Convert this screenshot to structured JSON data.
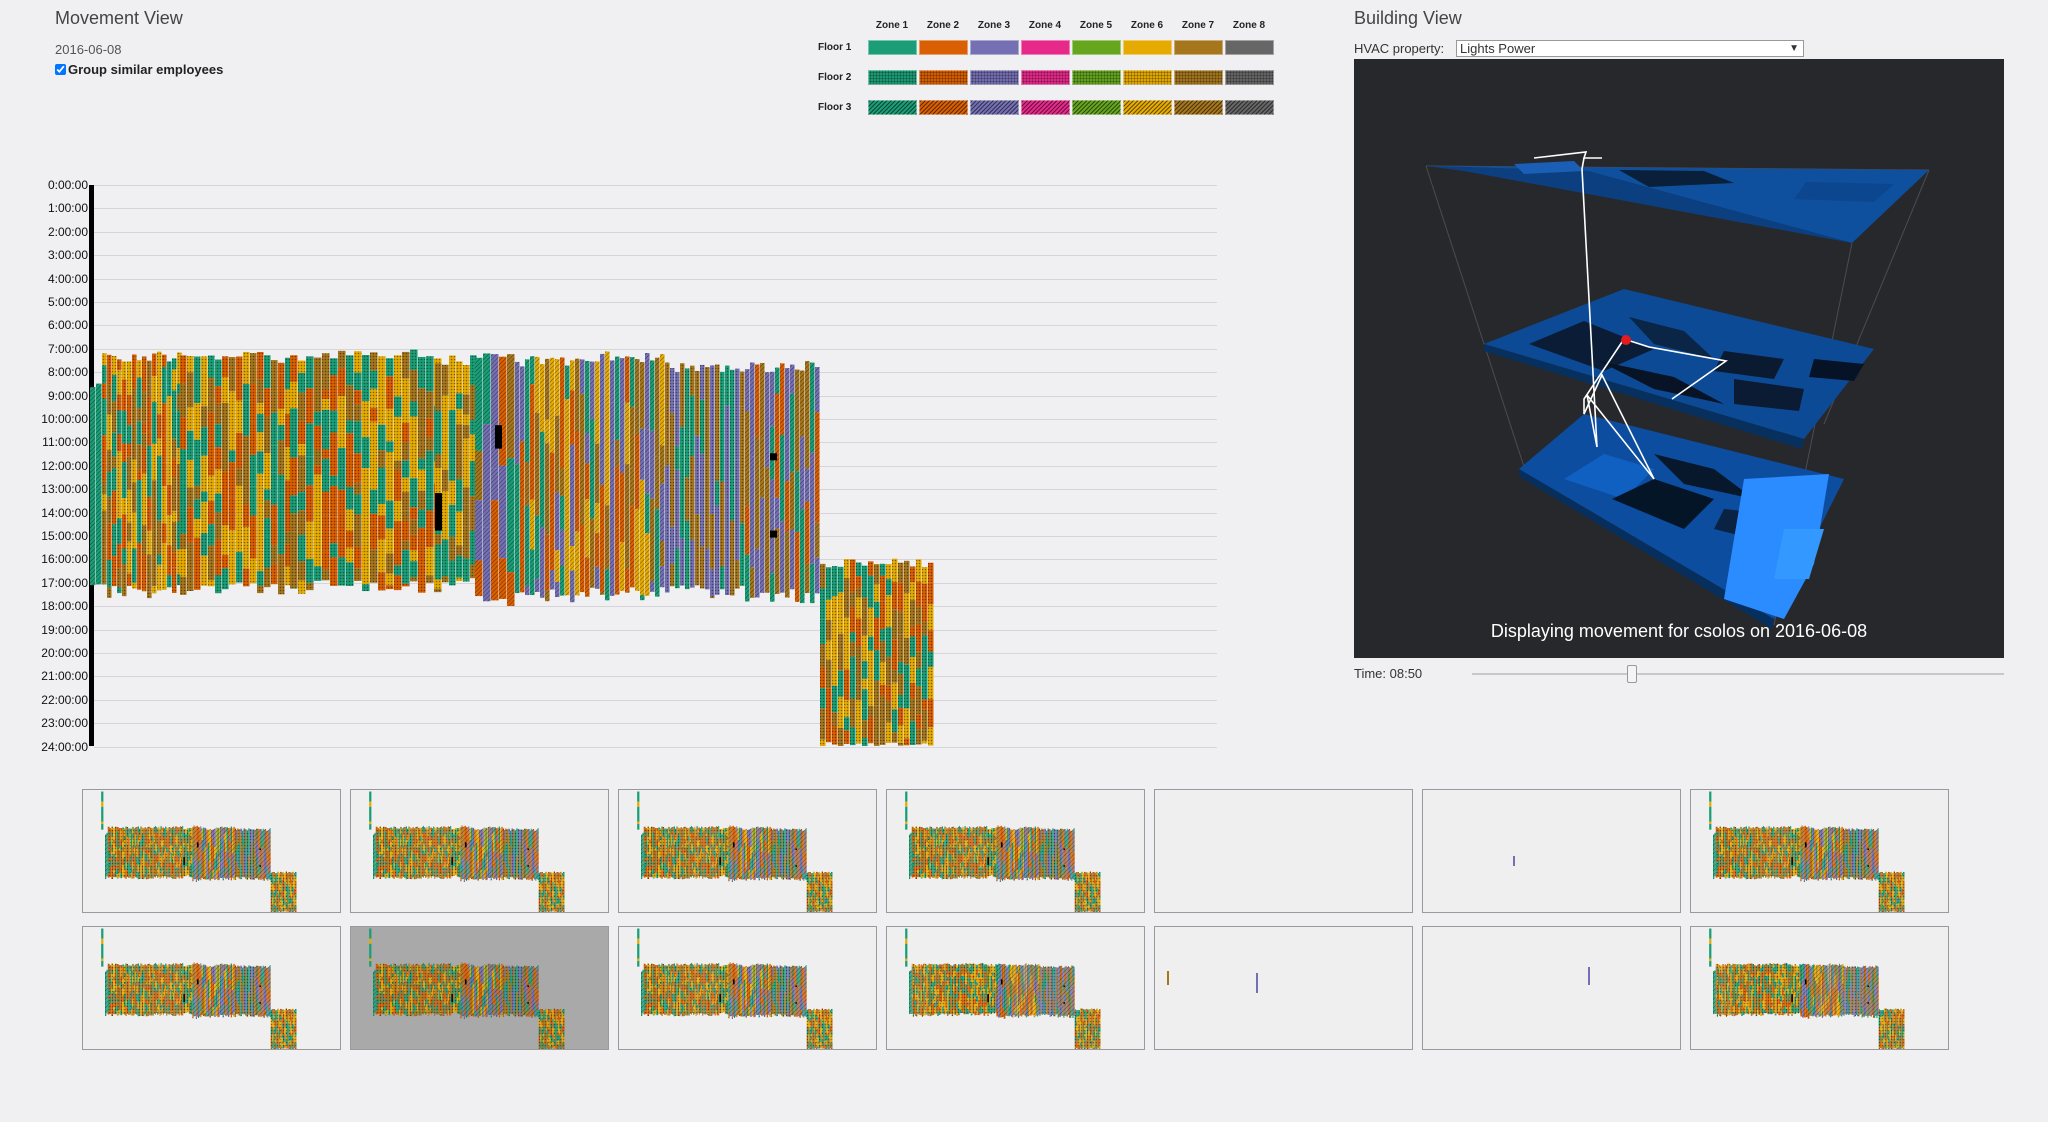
{
  "movement": {
    "title": "Movement View",
    "date": "2016-06-08",
    "group_label": "Group similar employees",
    "group_checked": true
  },
  "legend": {
    "zones": [
      "Zone 1",
      "Zone 2",
      "Zone 3",
      "Zone 4",
      "Zone 5",
      "Zone 6",
      "Zone 7",
      "Zone 8"
    ],
    "floors": [
      "Floor 1",
      "Floor 2",
      "Floor 3"
    ],
    "zone_colors": [
      "#1b9e77",
      "#d95f02",
      "#7570b3",
      "#e7298a",
      "#66a61e",
      "#e6ab02",
      "#a6761d",
      "#666666"
    ]
  },
  "time_axis": {
    "labels": [
      "0:00:00",
      "1:00:00",
      "2:00:00",
      "3:00:00",
      "4:00:00",
      "5:00:00",
      "6:00:00",
      "7:00:00",
      "8:00:00",
      "9:00:00",
      "10:00:00",
      "11:00:00",
      "12:00:00",
      "13:00:00",
      "14:00:00",
      "15:00:00",
      "16:00:00",
      "17:00:00",
      "18:00:00",
      "19:00:00",
      "20:00:00",
      "21:00:00",
      "22:00:00",
      "23:00:00",
      "24:00:00"
    ]
  },
  "building": {
    "title": "Building View",
    "hvac_label": "HVAC property:",
    "hvac_value": "Lights Power",
    "caption": "Displaying movement for csolos on 2016-06-08",
    "time_label": "Time: 08:50",
    "time_fraction": 0.3
  },
  "thumbnails": {
    "selected_index": 8,
    "count": 14,
    "empty_index": 4,
    "sparse_indices": [
      5,
      11,
      12
    ]
  }
}
